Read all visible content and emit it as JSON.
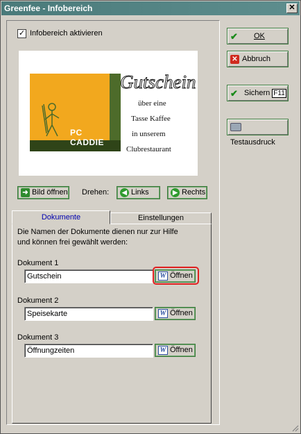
{
  "window": {
    "title": "Greenfee - Infobereich",
    "close": "✕"
  },
  "activate": {
    "checked": "✓",
    "label": "Infobereich aktivieren"
  },
  "preview": {
    "logo_text": "PC CADDIE",
    "voucher_title": "Gutschein",
    "voucher_lines": [
      "über eine",
      "Tasse Kaffee",
      "in unserem",
      "Clubrestaurant"
    ]
  },
  "image_controls": {
    "open_label": "Bild öffnen",
    "rotate_label": "Drehen:",
    "left_label": "Links",
    "right_label": "Rechts"
  },
  "tabs": [
    {
      "label": "Dokumente",
      "active": true
    },
    {
      "label": "Einstellungen",
      "active": false
    }
  ],
  "documents": {
    "hint_line1": "Die Namen der Dokumente dienen nur zur Hilfe",
    "hint_line2": "und können frei gewählt werden:",
    "items": [
      {
        "label": "Dokument 1",
        "value": "Gutschein",
        "open_label": "Öffnen"
      },
      {
        "label": "Dokument 2",
        "value": "Speisekarte",
        "open_label": "Öffnen"
      },
      {
        "label": "Dokument 3",
        "value": "Öffnungzeiten",
        "open_label": "Öffnen"
      }
    ]
  },
  "actions": {
    "ok_label": "OK",
    "cancel_label": "Abbruch",
    "save_label": "Sichern",
    "save_key": "F11",
    "print_label": "Testausdruck"
  },
  "colors": {
    "titlebar": "#4a7a7a",
    "highlight": "#e02020",
    "logo_orange": "#f2a81e",
    "logo_green": "#4d6b2a"
  }
}
